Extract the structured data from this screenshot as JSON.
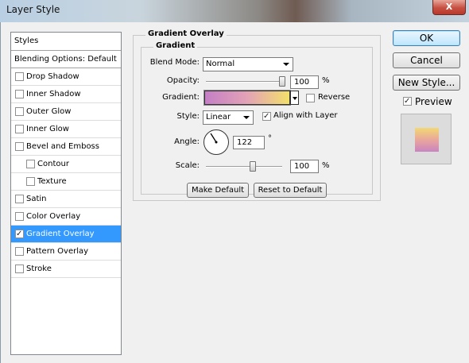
{
  "window": {
    "title": "Layer Style",
    "close_label": "X"
  },
  "styles_list": {
    "header": "Styles",
    "blending": "Blending Options: Default",
    "items": [
      {
        "label": "Drop Shadow",
        "checked": false,
        "sub": false
      },
      {
        "label": "Inner Shadow",
        "checked": false,
        "sub": false
      },
      {
        "label": "Outer Glow",
        "checked": false,
        "sub": false
      },
      {
        "label": "Inner Glow",
        "checked": false,
        "sub": false
      },
      {
        "label": "Bevel and Emboss",
        "checked": false,
        "sub": false
      },
      {
        "label": "Contour",
        "checked": false,
        "sub": true
      },
      {
        "label": "Texture",
        "checked": false,
        "sub": true
      },
      {
        "label": "Satin",
        "checked": false,
        "sub": false
      },
      {
        "label": "Color Overlay",
        "checked": false,
        "sub": false
      },
      {
        "label": "Gradient Overlay",
        "checked": true,
        "sub": false,
        "selected": true
      },
      {
        "label": "Pattern Overlay",
        "checked": false,
        "sub": false
      },
      {
        "label": "Stroke",
        "checked": false,
        "sub": false
      }
    ]
  },
  "panel": {
    "title": "Gradient Overlay",
    "group_title": "Gradient",
    "blend_mode_label": "Blend Mode:",
    "blend_mode_value": "Normal",
    "opacity_label": "Opacity:",
    "opacity_value": "100",
    "percent": "%",
    "gradient_label": "Gradient:",
    "gradient_colors": [
      "#c47fc6",
      "#e3a2b6",
      "#f3e06a"
    ],
    "reverse_label": "Reverse",
    "reverse_checked": false,
    "style_label": "Style:",
    "style_value": "Linear",
    "align_label": "Align with Layer",
    "align_checked": true,
    "angle_label": "Angle:",
    "angle_value": "122",
    "degree": "°",
    "scale_label": "Scale:",
    "scale_value": "100",
    "make_default": "Make Default",
    "reset_default": "Reset to Default"
  },
  "actions": {
    "ok": "OK",
    "cancel": "Cancel",
    "new_style": "New Style...",
    "preview_label": "Preview",
    "preview_checked": true
  }
}
